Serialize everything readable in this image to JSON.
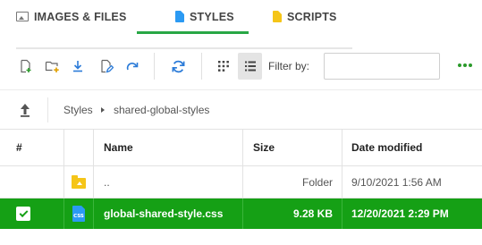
{
  "tabs": [
    {
      "label": "IMAGES & FILES",
      "icon": "image-icon",
      "active": false
    },
    {
      "label": "STYLES",
      "icon": "css-file-icon",
      "active": true
    },
    {
      "label": "SCRIPTS",
      "icon": "js-file-icon",
      "active": false
    }
  ],
  "colors": {
    "accent": "#28a745",
    "selected_row": "#15a015",
    "styles_icon": "#2b9af3",
    "scripts_icon": "#f5c518"
  },
  "toolbar": {
    "buttons": [
      "new-file-icon",
      "new-folder-icon",
      "download-icon",
      "edit-icon",
      "redo-icon",
      "refresh-icon",
      "grid-view-icon",
      "list-view-icon"
    ],
    "active_view": "list",
    "filter_label": "Filter by:",
    "filter_value": "",
    "more_icon": "more-options-icon"
  },
  "breadcrumb": {
    "up_icon": "up-arrow-icon",
    "root": "Styles",
    "current": "shared-global-styles"
  },
  "table": {
    "headers": {
      "check": "#",
      "icon": "",
      "name": "Name",
      "size": "Size",
      "date": "Date modified"
    },
    "rows": [
      {
        "selected": false,
        "icon": "folder-icon",
        "name": "..",
        "size": "Folder",
        "date": "9/10/2021 1:56 AM"
      },
      {
        "selected": true,
        "icon": "css-file-icon",
        "icon_text": "CSS",
        "name": "global-shared-style.css",
        "size": "9.28 KB",
        "date": "12/20/2021 2:29 PM"
      }
    ]
  }
}
